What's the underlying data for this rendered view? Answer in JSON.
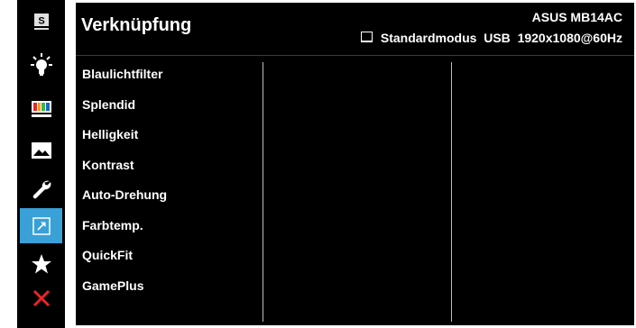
{
  "window": {
    "title": "Verknüpfung",
    "model": "ASUS MB14AC",
    "status_mode": "Standardmodus",
    "status_input": "USB",
    "status_resolution": "1920x1080@60Hz"
  },
  "sidebar": {
    "items": [
      {
        "icon": "s-icon",
        "active": false
      },
      {
        "icon": "bulb-icon",
        "active": false
      },
      {
        "icon": "color-bars-icon",
        "active": false
      },
      {
        "icon": "image-icon",
        "active": false
      },
      {
        "icon": "wrench-icon",
        "active": false
      },
      {
        "icon": "shortcut-arrow-icon",
        "active": true
      },
      {
        "icon": "star-icon",
        "active": false
      },
      {
        "icon": "close-x-icon",
        "active": false
      }
    ],
    "colors": {
      "active_bg": "#3aa0d8",
      "close_red": "#e8252b"
    }
  },
  "menu": {
    "items": [
      "Blaulichtfilter",
      "Splendid",
      "Helligkeit",
      "Kontrast",
      "Auto-Drehung",
      "Farbtemp.",
      "QuickFit",
      "GamePlus"
    ]
  }
}
